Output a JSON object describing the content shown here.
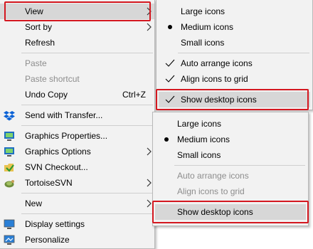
{
  "context_menu": {
    "items": [
      {
        "label": "View",
        "icon": "none",
        "submenu": true
      },
      {
        "label": "Sort by",
        "icon": "none",
        "submenu": true
      },
      {
        "label": "Refresh"
      },
      {
        "label": "Paste",
        "disabled": true
      },
      {
        "label": "Paste shortcut",
        "disabled": true
      },
      {
        "label": "Undo Copy",
        "shortcut": "Ctrl+Z"
      },
      {
        "label": "Send with Transfer...",
        "icon": "dropbox-icon"
      },
      {
        "label": "Graphics Properties...",
        "icon": "graphics-properties-icon"
      },
      {
        "label": "Graphics Options",
        "icon": "graphics-options-icon",
        "submenu": true
      },
      {
        "label": "SVN Checkout...",
        "icon": "svn-checkout-icon"
      },
      {
        "label": "TortoiseSVN",
        "icon": "tortoisesvn-icon",
        "submenu": true
      },
      {
        "label": "New",
        "submenu": true
      },
      {
        "label": "Display settings",
        "icon": "display-settings-icon"
      },
      {
        "label": "Personalize",
        "icon": "personalize-icon"
      }
    ]
  },
  "view_submenu_top": {
    "items": [
      {
        "label": "Large icons"
      },
      {
        "label": "Medium icons",
        "selected": true
      },
      {
        "label": "Small icons"
      },
      {
        "label": "Auto arrange icons",
        "checked": true
      },
      {
        "label": "Align icons to grid",
        "checked": true
      },
      {
        "label": "Show desktop icons",
        "checked": true
      }
    ]
  },
  "view_submenu_bottom": {
    "items": [
      {
        "label": "Large icons"
      },
      {
        "label": "Medium icons",
        "selected": true
      },
      {
        "label": "Small icons"
      },
      {
        "label": "Auto arrange icons",
        "disabled": true
      },
      {
        "label": "Align icons to grid",
        "disabled": true
      },
      {
        "label": "Show desktop icons",
        "checked": false
      }
    ]
  },
  "colors": {
    "menu_bg": "#f2f2f2",
    "highlight": "#d7d7d7",
    "annotation_red": "#d41820",
    "disabled_text": "#8d8d8d"
  }
}
